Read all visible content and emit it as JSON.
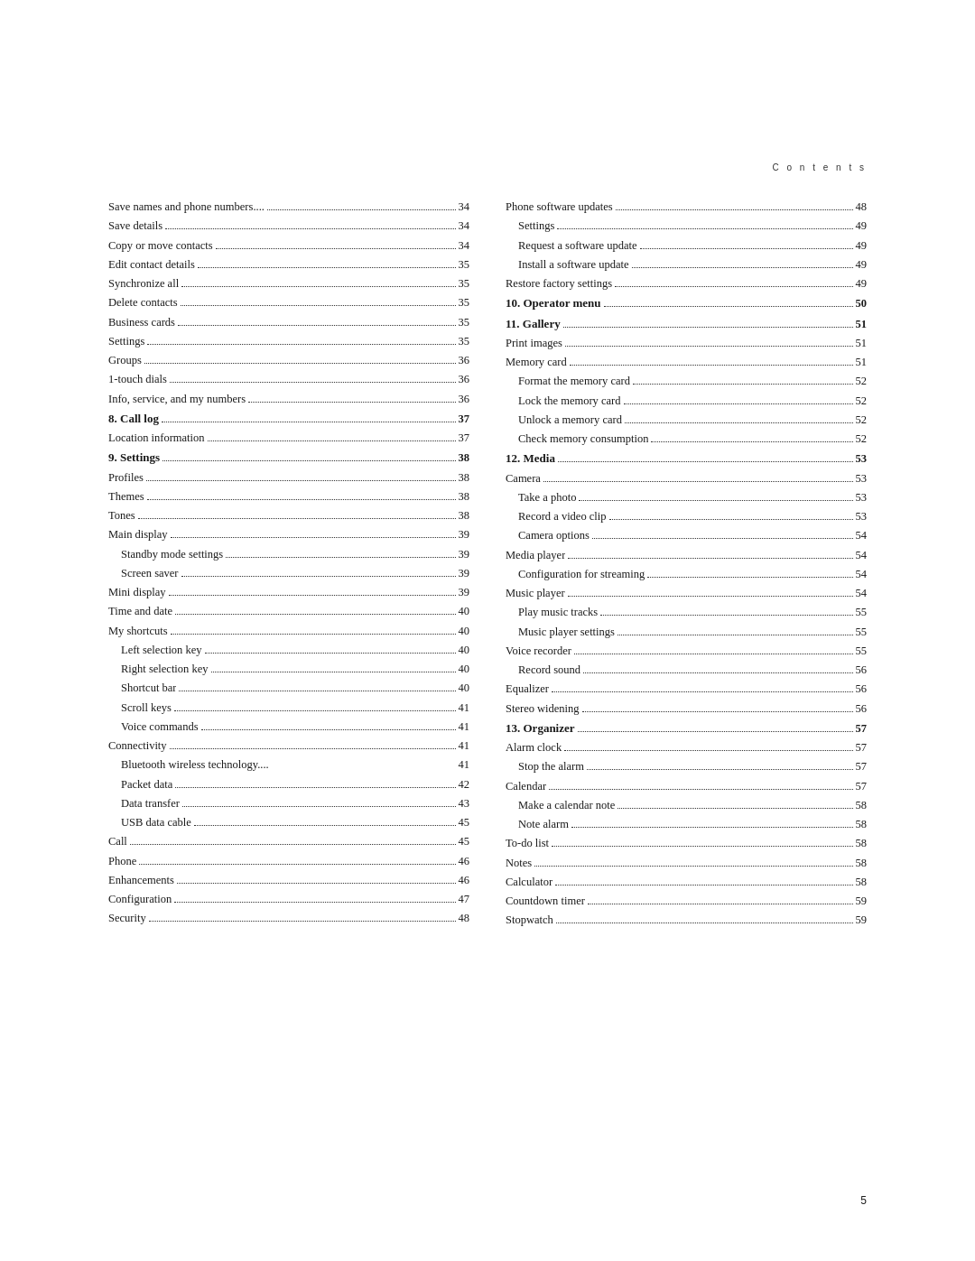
{
  "header": {
    "text": "C o n t e n t s"
  },
  "page_number": "5",
  "left_column": [
    {
      "text": "Save names and phone numbers....",
      "page": "34",
      "level": "normal",
      "dots": true
    },
    {
      "text": "Save details",
      "page": "34",
      "level": "normal",
      "dots": true
    },
    {
      "text": "Copy or move contacts",
      "page": "34",
      "level": "normal",
      "dots": true
    },
    {
      "text": "Edit contact details",
      "page": "35",
      "level": "normal",
      "dots": true
    },
    {
      "text": "Synchronize all",
      "page": "35",
      "level": "normal",
      "dots": true
    },
    {
      "text": "Delete contacts",
      "page": "35",
      "level": "normal",
      "dots": true
    },
    {
      "text": "Business cards",
      "page": "35",
      "level": "normal",
      "dots": true
    },
    {
      "text": "Settings",
      "page": "35",
      "level": "normal",
      "dots": true
    },
    {
      "text": "Groups",
      "page": "36",
      "level": "normal",
      "dots": true
    },
    {
      "text": "1-touch dials",
      "page": "36",
      "level": "normal",
      "dots": true
    },
    {
      "text": "Info, service, and my numbers",
      "page": "36",
      "level": "normal",
      "dots": true
    },
    {
      "text": "8.  Call log",
      "page": "37",
      "level": "heading",
      "dots": true
    },
    {
      "text": "Location information",
      "page": "37",
      "level": "normal",
      "dots": true
    },
    {
      "text": "9.  Settings",
      "page": "38",
      "level": "heading",
      "dots": true
    },
    {
      "text": "Profiles",
      "page": "38",
      "level": "normal",
      "dots": true
    },
    {
      "text": "Themes",
      "page": "38",
      "level": "normal",
      "dots": true
    },
    {
      "text": "Tones",
      "page": "38",
      "level": "normal",
      "dots": true
    },
    {
      "text": "Main display",
      "page": "39",
      "level": "normal",
      "dots": true
    },
    {
      "text": "Standby mode settings",
      "page": "39",
      "level": "sub",
      "dots": true
    },
    {
      "text": "Screen saver",
      "page": "39",
      "level": "sub",
      "dots": true
    },
    {
      "text": "Mini display",
      "page": "39",
      "level": "normal",
      "dots": true
    },
    {
      "text": "Time and date",
      "page": "40",
      "level": "normal",
      "dots": true
    },
    {
      "text": "My shortcuts",
      "page": "40",
      "level": "normal",
      "dots": true
    },
    {
      "text": "Left selection key",
      "page": "40",
      "level": "sub",
      "dots": true
    },
    {
      "text": "Right selection key",
      "page": "40",
      "level": "sub",
      "dots": true
    },
    {
      "text": "Shortcut bar",
      "page": "40",
      "level": "sub",
      "dots": true
    },
    {
      "text": "Scroll keys",
      "page": "41",
      "level": "sub",
      "dots": true
    },
    {
      "text": "Voice commands",
      "page": "41",
      "level": "sub",
      "dots": true
    },
    {
      "text": "Connectivity",
      "page": "41",
      "level": "normal",
      "dots": true
    },
    {
      "text": "Bluetooth wireless technology....",
      "page": "41",
      "level": "sub",
      "dots": false
    },
    {
      "text": "Packet data",
      "page": "42",
      "level": "sub",
      "dots": true
    },
    {
      "text": "Data transfer",
      "page": "43",
      "level": "sub",
      "dots": true
    },
    {
      "text": "USB data cable",
      "page": "45",
      "level": "sub",
      "dots": true
    },
    {
      "text": "Call",
      "page": "45",
      "level": "normal",
      "dots": true
    },
    {
      "text": "Phone",
      "page": "46",
      "level": "normal",
      "dots": true
    },
    {
      "text": "Enhancements",
      "page": "46",
      "level": "normal",
      "dots": true
    },
    {
      "text": "Configuration",
      "page": "47",
      "level": "normal",
      "dots": true
    },
    {
      "text": "Security",
      "page": "48",
      "level": "normal",
      "dots": true
    }
  ],
  "right_column": [
    {
      "text": "Phone software updates",
      "page": "48",
      "level": "normal",
      "dots": true
    },
    {
      "text": "Settings",
      "page": "49",
      "level": "sub",
      "dots": true
    },
    {
      "text": "Request a software update",
      "page": "49",
      "level": "sub",
      "dots": true
    },
    {
      "text": "Install a software update",
      "page": "49",
      "level": "sub",
      "dots": true
    },
    {
      "text": "Restore factory settings",
      "page": "49",
      "level": "normal",
      "dots": true
    },
    {
      "text": "10. Operator menu",
      "page": "50",
      "level": "heading",
      "dots": true
    },
    {
      "text": "11. Gallery",
      "page": "51",
      "level": "heading",
      "dots": true
    },
    {
      "text": "Print images",
      "page": "51",
      "level": "normal",
      "dots": true
    },
    {
      "text": "Memory card",
      "page": "51",
      "level": "normal",
      "dots": true
    },
    {
      "text": "Format the memory card",
      "page": "52",
      "level": "sub",
      "dots": true
    },
    {
      "text": "Lock the memory card",
      "page": "52",
      "level": "sub",
      "dots": true
    },
    {
      "text": "Unlock a memory card",
      "page": "52",
      "level": "sub",
      "dots": true
    },
    {
      "text": "Check memory consumption",
      "page": "52",
      "level": "sub",
      "dots": true
    },
    {
      "text": "12. Media",
      "page": "53",
      "level": "heading",
      "dots": true
    },
    {
      "text": "Camera",
      "page": "53",
      "level": "normal",
      "dots": true
    },
    {
      "text": "Take a photo",
      "page": "53",
      "level": "sub",
      "dots": true
    },
    {
      "text": "Record a video clip",
      "page": "53",
      "level": "sub",
      "dots": true
    },
    {
      "text": "Camera options",
      "page": "54",
      "level": "sub",
      "dots": true
    },
    {
      "text": "Media player",
      "page": "54",
      "level": "normal",
      "dots": true
    },
    {
      "text": "Configuration for streaming",
      "page": "54",
      "level": "sub",
      "dots": true
    },
    {
      "text": "Music player",
      "page": "54",
      "level": "normal",
      "dots": true
    },
    {
      "text": "Play music tracks",
      "page": "55",
      "level": "sub",
      "dots": true
    },
    {
      "text": "Music player settings",
      "page": "55",
      "level": "sub",
      "dots": true
    },
    {
      "text": "Voice recorder",
      "page": "55",
      "level": "normal",
      "dots": true
    },
    {
      "text": "Record sound",
      "page": "56",
      "level": "sub",
      "dots": true
    },
    {
      "text": "Equalizer",
      "page": "56",
      "level": "normal",
      "dots": true
    },
    {
      "text": "Stereo widening",
      "page": "56",
      "level": "normal",
      "dots": true
    },
    {
      "text": "13. Organizer",
      "page": "57",
      "level": "heading",
      "dots": true
    },
    {
      "text": "Alarm clock",
      "page": "57",
      "level": "normal",
      "dots": true
    },
    {
      "text": "Stop the alarm",
      "page": "57",
      "level": "sub",
      "dots": true
    },
    {
      "text": "Calendar",
      "page": "57",
      "level": "normal",
      "dots": true
    },
    {
      "text": "Make a calendar note",
      "page": "58",
      "level": "sub",
      "dots": true
    },
    {
      "text": "Note alarm",
      "page": "58",
      "level": "sub",
      "dots": true
    },
    {
      "text": "To-do list",
      "page": "58",
      "level": "normal",
      "dots": true
    },
    {
      "text": "Notes",
      "page": "58",
      "level": "normal",
      "dots": true
    },
    {
      "text": "Calculator",
      "page": "58",
      "level": "normal",
      "dots": true
    },
    {
      "text": "Countdown timer",
      "page": "59",
      "level": "normal",
      "dots": true
    },
    {
      "text": "Stopwatch",
      "page": "59",
      "level": "normal",
      "dots": true
    }
  ]
}
